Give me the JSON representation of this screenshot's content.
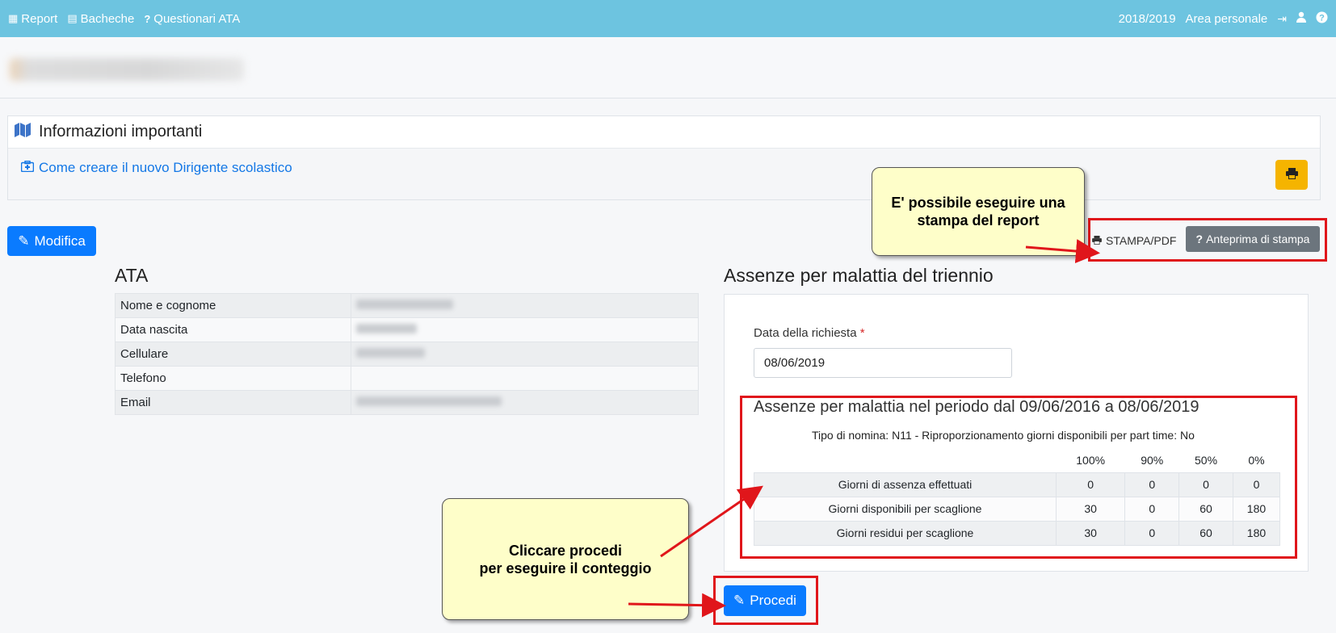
{
  "navbar": {
    "items": [
      {
        "icon": "table-icon",
        "label": "Report"
      },
      {
        "icon": "list-icon",
        "label": "Bacheche"
      },
      {
        "icon": "question-icon",
        "label": "Questionari ATA"
      }
    ],
    "year": "2018/2019",
    "area": "Area personale"
  },
  "info": {
    "title": "Informazioni importanti",
    "link": "Come creare il nuovo Dirigente scolastico"
  },
  "actions": {
    "modifica": "Modifica",
    "stampa": "STAMPA/PDF",
    "anteprima": "Anteprima di stampa",
    "procedi": "Procedi"
  },
  "ata": {
    "title": "ATA",
    "rows": [
      {
        "label": "Nome e cognome"
      },
      {
        "label": "Data nascita"
      },
      {
        "label": "Cellulare"
      },
      {
        "label": "Telefono"
      },
      {
        "label": "Email"
      }
    ]
  },
  "assenze": {
    "title": "Assenze per malattia del triennio",
    "date_label": "Data della richiesta",
    "required_mark": "*",
    "date_value": "08/06/2019",
    "periodo_title": "Assenze per malattia nel periodo dal 09/06/2016 a 08/06/2019",
    "tipo_nomina": "Tipo di nomina: N11 - Riproporzionamento giorni disponibili per part time: No",
    "columns": [
      "100%",
      "90%",
      "50%",
      "0%"
    ],
    "rows": [
      {
        "label": "Giorni di assenza effettuati",
        "values": [
          "0",
          "0",
          "0",
          "0"
        ]
      },
      {
        "label": "Giorni disponibili per scaglione",
        "values": [
          "30",
          "0",
          "60",
          "180"
        ]
      },
      {
        "label": "Giorni residui per scaglione",
        "values": [
          "30",
          "0",
          "60",
          "180"
        ]
      }
    ]
  },
  "callouts": {
    "top_line1": "E' possibile eseguire una",
    "top_line2": "stampa del report",
    "bottom_line1": "Cliccare procedi",
    "bottom_line2": "per eseguire il conteggio"
  },
  "colors": {
    "navbar": "#6dc4e0",
    "primary": "#0a7bff",
    "warning": "#f5b400",
    "secondary": "#6c757d",
    "annotation_red": "#e0161b",
    "callout_bg": "#fefec9"
  }
}
